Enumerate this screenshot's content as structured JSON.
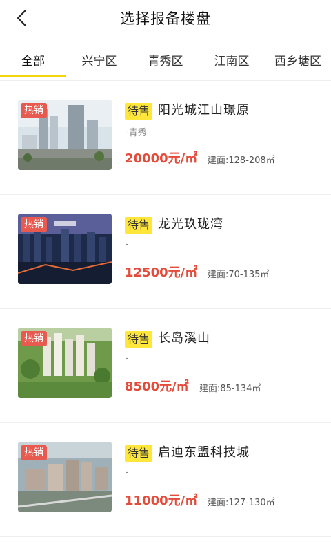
{
  "header": {
    "title": "选择报备楼盘",
    "back_icon": "chevron-left-icon"
  },
  "tabs": [
    {
      "label": "全部",
      "active": true
    },
    {
      "label": "兴宁区",
      "active": false
    },
    {
      "label": "青秀区",
      "active": false
    },
    {
      "label": "江南区",
      "active": false
    },
    {
      "label": "西乡塘区",
      "active": false
    }
  ],
  "colors": {
    "accent_yellow": "#f5d60c",
    "status_tag_bg": "#ffe63b",
    "hot_tag_bg": "#e85a4f",
    "price_red": "#e34b3a"
  },
  "listings": [
    {
      "hot_tag": "热销",
      "status": "待售",
      "name": "阳光城江山璟原",
      "district": "-青秀",
      "price": "20000元/㎡",
      "area": "建面:128-208㎡"
    },
    {
      "hot_tag": "热销",
      "status": "待售",
      "name": "龙光玖珑湾",
      "district": "-",
      "price": "12500元/㎡",
      "area": "建面:70-135㎡"
    },
    {
      "hot_tag": "热销",
      "status": "待售",
      "name": "长岛溪山",
      "district": "-",
      "price": "8500元/㎡",
      "area": "建面:85-134㎡"
    },
    {
      "hot_tag": "热销",
      "status": "待售",
      "name": "启迪东盟科技城",
      "district": "-",
      "price": "11000元/㎡",
      "area": "建面:127-130㎡"
    }
  ]
}
